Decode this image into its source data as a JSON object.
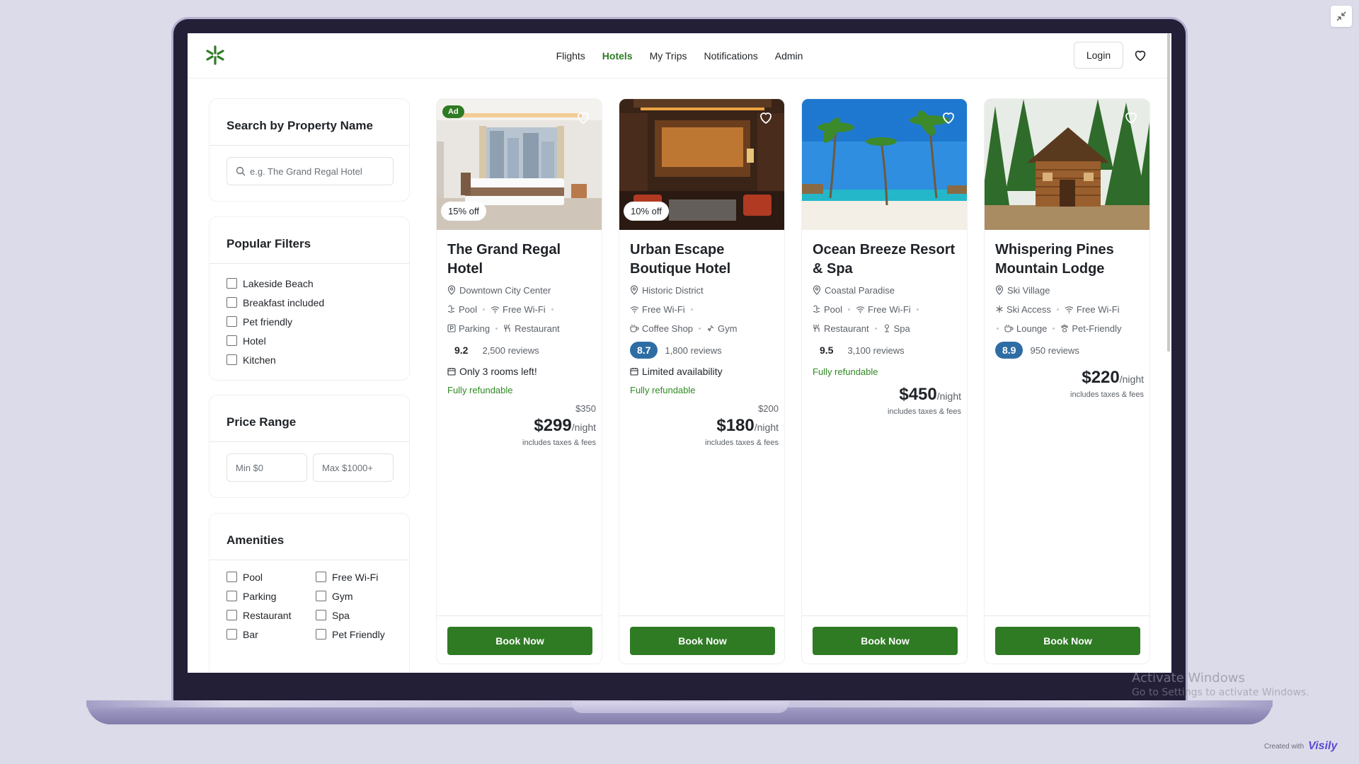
{
  "nav": {
    "items": [
      "Flights",
      "Hotels",
      "My Trips",
      "Notifications",
      "Admin"
    ],
    "active": "Hotels",
    "login_label": "Login"
  },
  "sidebar": {
    "search": {
      "title": "Search by Property Name",
      "placeholder": "e.g. The Grand Regal Hotel"
    },
    "popular": {
      "title": "Popular Filters",
      "items": [
        "Lakeside Beach",
        "Breakfast included",
        "Pet friendly",
        "Hotel",
        "Kitchen"
      ]
    },
    "price": {
      "title": "Price Range",
      "min_placeholder": "Min $0",
      "max_placeholder": "Max $1000+"
    },
    "amenities": {
      "title": "Amenities",
      "items": [
        "Pool",
        "Free Wi-Fi",
        "Parking",
        "Gym",
        "Restaurant",
        "Spa",
        "Bar",
        "Pet Friendly"
      ]
    }
  },
  "hotels": [
    {
      "name": "The Grand Regal Hotel",
      "location": "Downtown City Center",
      "amenities_line1": [
        "Pool",
        "Free Wi-Fi"
      ],
      "amenities_line2": [
        "Parking",
        "Restaurant"
      ],
      "score": "9.2",
      "reviews": "2,500 reviews",
      "availability": "Only 3 rooms left!",
      "refundable": "Fully refundable",
      "old_price": "$350",
      "price": "$299",
      "per_night": "/night",
      "taxes": "includes taxes & fees",
      "ad": "Ad",
      "discount": "15% off",
      "book_label": "Book Now"
    },
    {
      "name": "Urban Escape Boutique Hotel",
      "location": "Historic District",
      "amenities_line1": [
        "Free Wi-Fi"
      ],
      "amenities_line2": [
        "Coffee Shop",
        "Gym"
      ],
      "score": "8.7",
      "reviews": "1,800 reviews",
      "availability": "Limited availability",
      "refundable": "Fully refundable",
      "old_price": "$200",
      "price": "$180",
      "per_night": "/night",
      "taxes": "includes taxes & fees",
      "discount": "10% off",
      "book_label": "Book Now"
    },
    {
      "name": "Ocean Breeze Resort & Spa",
      "location": "Coastal Paradise",
      "amenities_line1": [
        "Pool",
        "Free Wi-Fi"
      ],
      "amenities_line2": [
        "Restaurant",
        "Spa"
      ],
      "score": "9.5",
      "reviews": "3,100 reviews",
      "refundable": "Fully refundable",
      "price": "$450",
      "per_night": "/night",
      "taxes": "includes taxes & fees",
      "book_label": "Book Now"
    },
    {
      "name": "Whispering Pines Mountain Lodge",
      "location": "Ski Village",
      "amenities_line1": [
        "Ski Access",
        "Free Wi-Fi"
      ],
      "amenities_line2": [
        "Lounge",
        "Pet-Friendly"
      ],
      "score": "8.9",
      "reviews": "950 reviews",
      "price": "$220",
      "per_night": "/night",
      "taxes": "includes taxes & fees",
      "book_label": "Book Now"
    }
  ],
  "watermark": {
    "line1": "Activate Windows",
    "line2": "Go to Settings to activate Windows."
  },
  "credit": {
    "prefix": "Created with",
    "brand": "Visily"
  },
  "colors": {
    "brand_green": "#2f7b24",
    "refund_green": "#2f8a22",
    "score_blue": "#2e6da4",
    "backdrop": "#dcdbe9"
  }
}
